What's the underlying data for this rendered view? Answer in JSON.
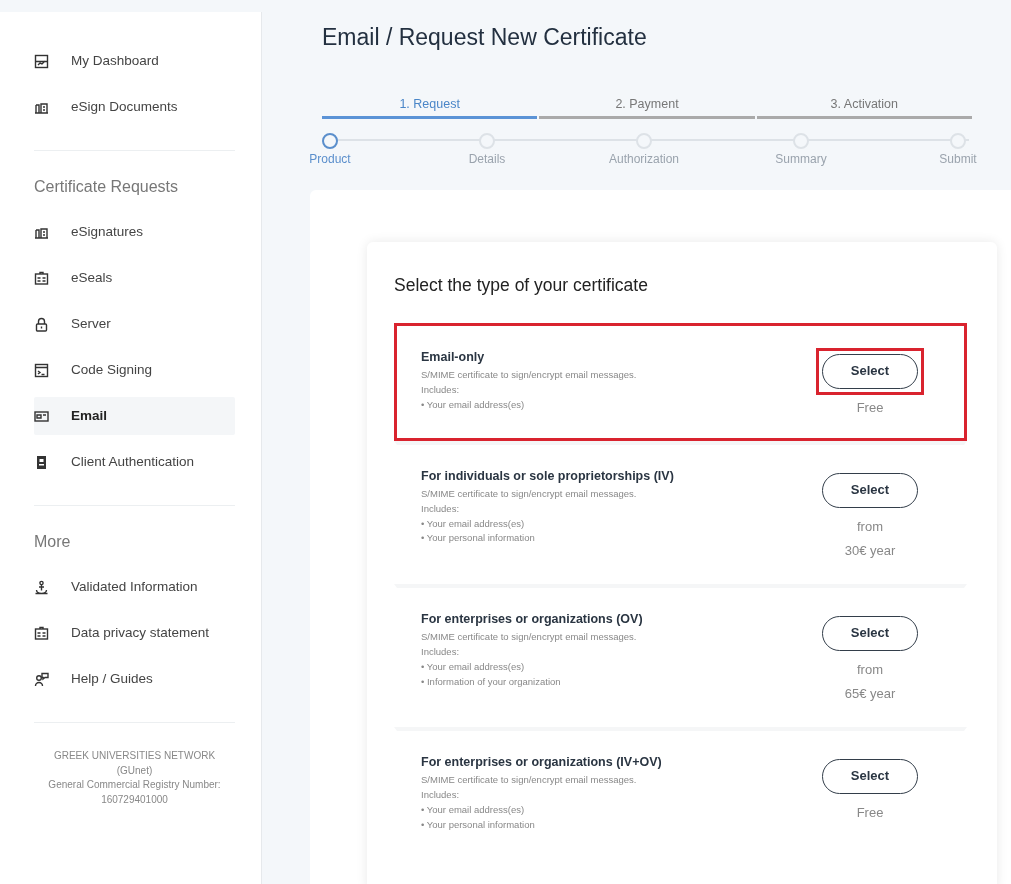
{
  "sidebar": {
    "groups": [
      {
        "items": [
          {
            "label": "My Dashboard",
            "selected": false
          },
          {
            "label": "eSign Documents",
            "selected": false
          }
        ]
      },
      {
        "heading": "Certificate Requests",
        "items": [
          {
            "label": "eSignatures",
            "selected": false
          },
          {
            "label": "eSeals",
            "selected": false
          },
          {
            "label": "Server",
            "selected": false
          },
          {
            "label": "Code Signing",
            "selected": false
          },
          {
            "label": "Email",
            "selected": true
          },
          {
            "label": "Client Authentication",
            "selected": false
          }
        ]
      },
      {
        "heading": "More",
        "items": [
          {
            "label": "Validated Information",
            "selected": false
          },
          {
            "label": "Data privacy statement",
            "selected": false
          },
          {
            "label": "Help / Guides",
            "selected": false
          }
        ]
      }
    ],
    "footer": [
      "GREEK UNIVERSITIES NETWORK",
      "(GUnet)",
      "General Commercial Registry Number:",
      "160729401000"
    ]
  },
  "page_title": "Email / Request New Certificate",
  "phases": [
    {
      "label": "1. Request",
      "selected": true
    },
    {
      "label": "2. Payment",
      "selected": false
    },
    {
      "label": "3. Activation",
      "selected": false
    }
  ],
  "steps": [
    {
      "label": "Product",
      "selected": true
    },
    {
      "label": "Details",
      "selected": false
    },
    {
      "label": "Authorization",
      "selected": false
    },
    {
      "label": "Summary",
      "selected": false
    },
    {
      "label": "Submit",
      "selected": false
    }
  ],
  "card": {
    "title": "Select the type of your certificate",
    "options": [
      {
        "title": "Email-only",
        "lines": [
          "S/MIME certificate to sign/encrypt email messages.",
          "Includes:",
          "• Your email address(es)"
        ],
        "button": "Select",
        "highlighted": true,
        "button_highlighted": true,
        "price": [
          "Free"
        ]
      },
      {
        "title": "For individuals or sole proprietorships (IV)",
        "lines": [
          "S/MIME certificate to sign/encrypt email messages.",
          "Includes:",
          "• Your email address(es)",
          "• Your personal information"
        ],
        "button": "Select",
        "highlighted": false,
        "button_highlighted": false,
        "price": [
          "from",
          "30€ year"
        ]
      },
      {
        "title": "For enterprises or organizations (OV)",
        "lines": [
          "S/MIME certificate to sign/encrypt email messages.",
          "Includes:",
          "• Your email address(es)",
          "• Information of your organization"
        ],
        "button": "Select",
        "highlighted": false,
        "button_highlighted": false,
        "price": [
          "from",
          "65€ year"
        ]
      },
      {
        "title": "For enterprises or organizations (IV+OV)",
        "lines": [
          "S/MIME certificate to sign/encrypt email messages.",
          "Includes:",
          "• Your email address(es)",
          "• Your personal information"
        ],
        "button": "Select",
        "highlighted": false,
        "button_highlighted": false,
        "price": [
          "Free"
        ]
      }
    ]
  }
}
